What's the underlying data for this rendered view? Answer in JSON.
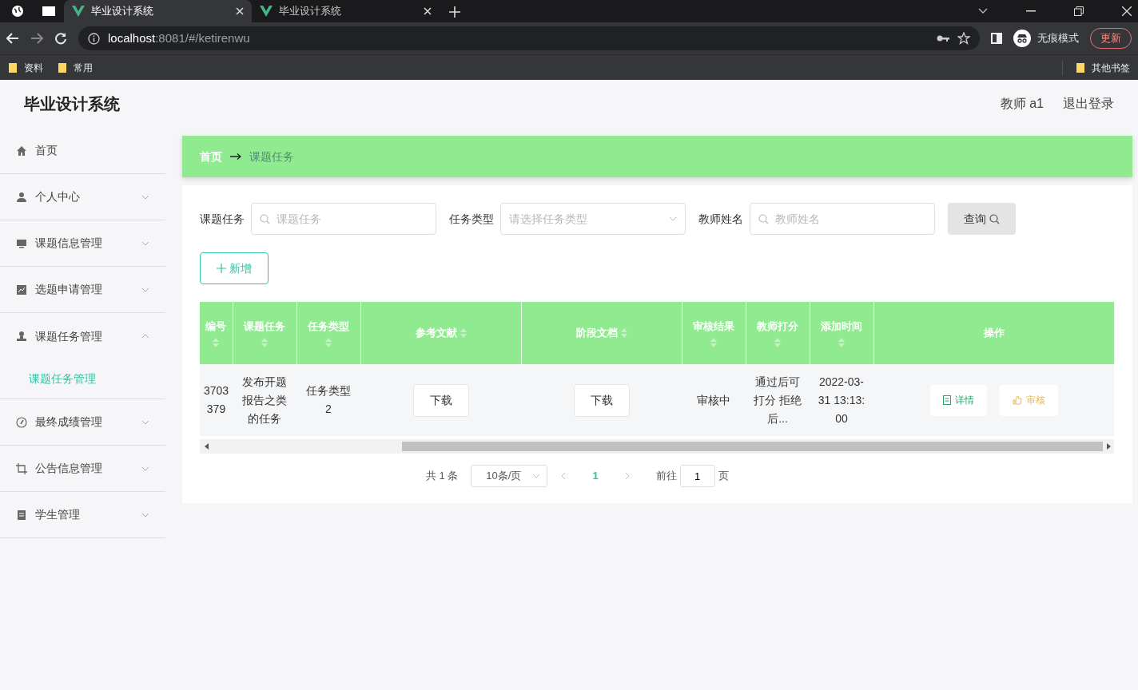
{
  "browser": {
    "tabs": [
      {
        "title": "毕业设计系统",
        "selected": true
      },
      {
        "title": "毕业设计系统",
        "selected": false
      }
    ],
    "url_host": "localhost",
    "url_path": ":8081/#/ketirenwu",
    "profile": "无痕模式",
    "update_button": "更新",
    "bookmarks": [
      {
        "label": "资料"
      },
      {
        "label": "常用"
      }
    ],
    "other_bookmarks": "其他书签"
  },
  "app": {
    "title": "毕业设计系统",
    "user": "教师 a1",
    "logout": "退出登录"
  },
  "sidebar": {
    "items": [
      {
        "label": "首页",
        "kind": "link"
      },
      {
        "label": "个人中心",
        "kind": "menu",
        "expanded": false
      },
      {
        "label": "课题信息管理",
        "kind": "menu",
        "expanded": false
      },
      {
        "label": "选题申请管理",
        "kind": "menu",
        "expanded": false
      },
      {
        "label": "课题任务管理",
        "kind": "menu",
        "expanded": true,
        "children": [
          {
            "label": "课题任务管理",
            "selected": true
          }
        ]
      },
      {
        "label": "最终成绩管理",
        "kind": "menu",
        "expanded": false
      },
      {
        "label": "公告信息管理",
        "kind": "menu",
        "expanded": false
      },
      {
        "label": "学生管理",
        "kind": "menu",
        "expanded": false
      }
    ]
  },
  "breadcrumb": [
    {
      "label": "首页"
    },
    {
      "label": "课题任务"
    }
  ],
  "filters": [
    {
      "label": "课题任务",
      "placeholder": "课题任务",
      "kind": "search"
    },
    {
      "label": "任务类型",
      "placeholder": "请选择任务类型",
      "kind": "select"
    },
    {
      "label": "教师姓名",
      "placeholder": "教师姓名",
      "kind": "search"
    }
  ],
  "query_button": "查询",
  "add_button": "新增",
  "table": {
    "columns": [
      {
        "label": "编号",
        "sortable": true
      },
      {
        "label": "课题任务",
        "sortable": true
      },
      {
        "label": "任务类型",
        "sortable": true
      },
      {
        "label": "参考文献",
        "sortable": true
      },
      {
        "label": "阶段文档",
        "sortable": true
      },
      {
        "label": "审核结果",
        "sortable": true
      },
      {
        "label": "教师打分",
        "sortable": true
      },
      {
        "label": "添加时间",
        "sortable": true
      },
      {
        "label": "操作",
        "sortable": false
      }
    ],
    "rows": [
      {
        "cells": [
          {
            "kind": "text",
            "text": "3703379"
          },
          {
            "kind": "text",
            "text": "发布开题报告之类的任务"
          },
          {
            "kind": "text",
            "text": "任务类型2"
          },
          {
            "kind": "button",
            "text": "下载"
          },
          {
            "kind": "button",
            "text": "下载"
          },
          {
            "kind": "text",
            "text": "审核中"
          },
          {
            "kind": "text",
            "text": "通过后可打分 拒绝后..."
          },
          {
            "kind": "text",
            "text": "2022-03-31 13:13:00"
          }
        ],
        "actions": [
          {
            "label": "详情",
            "kind": "detail"
          },
          {
            "label": "审核",
            "kind": "review"
          }
        ]
      }
    ]
  },
  "pagination": {
    "total": "共 1 条",
    "page_size": "10条/页",
    "pages": [
      {
        "label": "1",
        "selected": true
      }
    ],
    "goto_label": "前往",
    "goto_value": "1",
    "page_unit": "页"
  }
}
